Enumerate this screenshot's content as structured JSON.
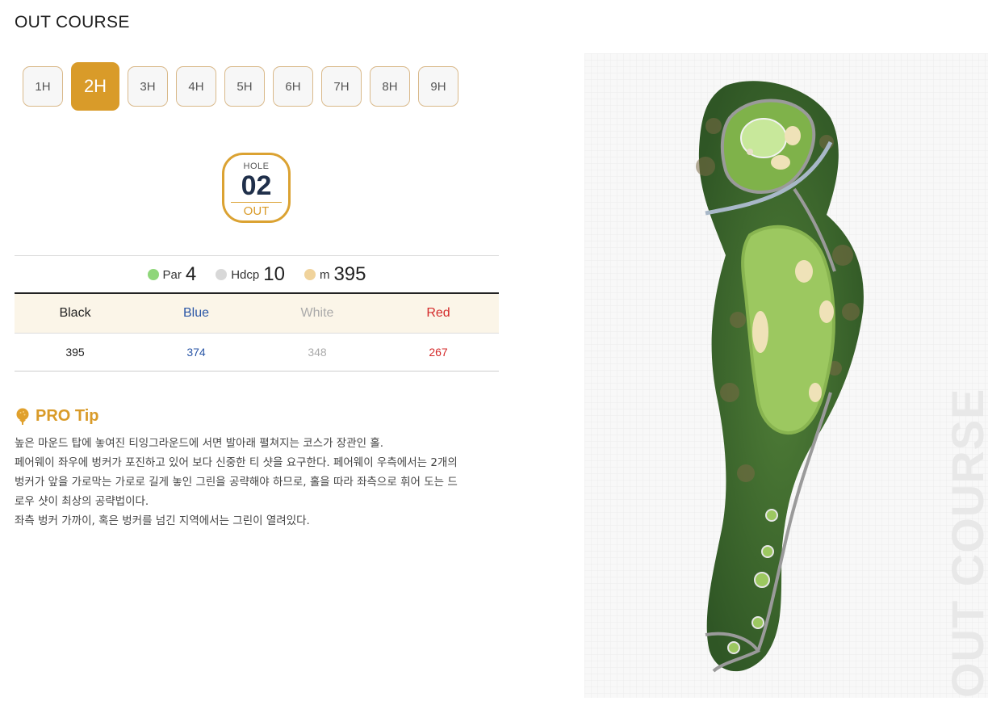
{
  "course_title": "OUT COURSE",
  "hole_tabs": [
    "1H",
    "2H",
    "3H",
    "4H",
    "5H",
    "6H",
    "7H",
    "8H",
    "9H"
  ],
  "active_hole_index": 1,
  "hole_badge": {
    "label": "HOLE",
    "number": "02",
    "course": "OUT"
  },
  "stats": {
    "par": {
      "label": "Par",
      "value": "4",
      "color": "#8fd67a"
    },
    "hdcp": {
      "label": "Hdcp",
      "value": "10",
      "color": "#d8d8d8"
    },
    "distance": {
      "label": "m",
      "value": "395",
      "color": "#f0d39c"
    }
  },
  "tees": {
    "headers": [
      "Black",
      "Blue",
      "White",
      "Red"
    ],
    "values": [
      "395",
      "374",
      "348",
      "267"
    ],
    "colors": [
      "#222222",
      "#2a56a6",
      "#aaaaaa",
      "#d42b2b"
    ]
  },
  "pro_tip": {
    "title": "PRO Tip",
    "lines": [
      "높은 마운드 탑에 놓여진 티잉그라운드에 서면 발아래 펼쳐지는 코스가 장관인 홀.",
      "페어웨이 좌우에 벙커가 포진하고 있어 보다 신중한 티 샷을 요구한다. 페어웨이 우측에서는 2개의",
      "벙커가 앞을 가로막는 가로로 길게 놓인 그린을 공략해야 하므로, 홀을 따라 좌측으로 휘어 도는 드",
      "로우 샷이 최상의 공략법이다.",
      "좌측 벙커 가까이, 혹은 벙커를 넘긴 지역에서는 그린이 열려있다."
    ]
  },
  "map": {
    "watermark": "OUT COURSE"
  },
  "colors": {
    "accent": "#d99b29",
    "badge_text": "#1f2f4a"
  }
}
